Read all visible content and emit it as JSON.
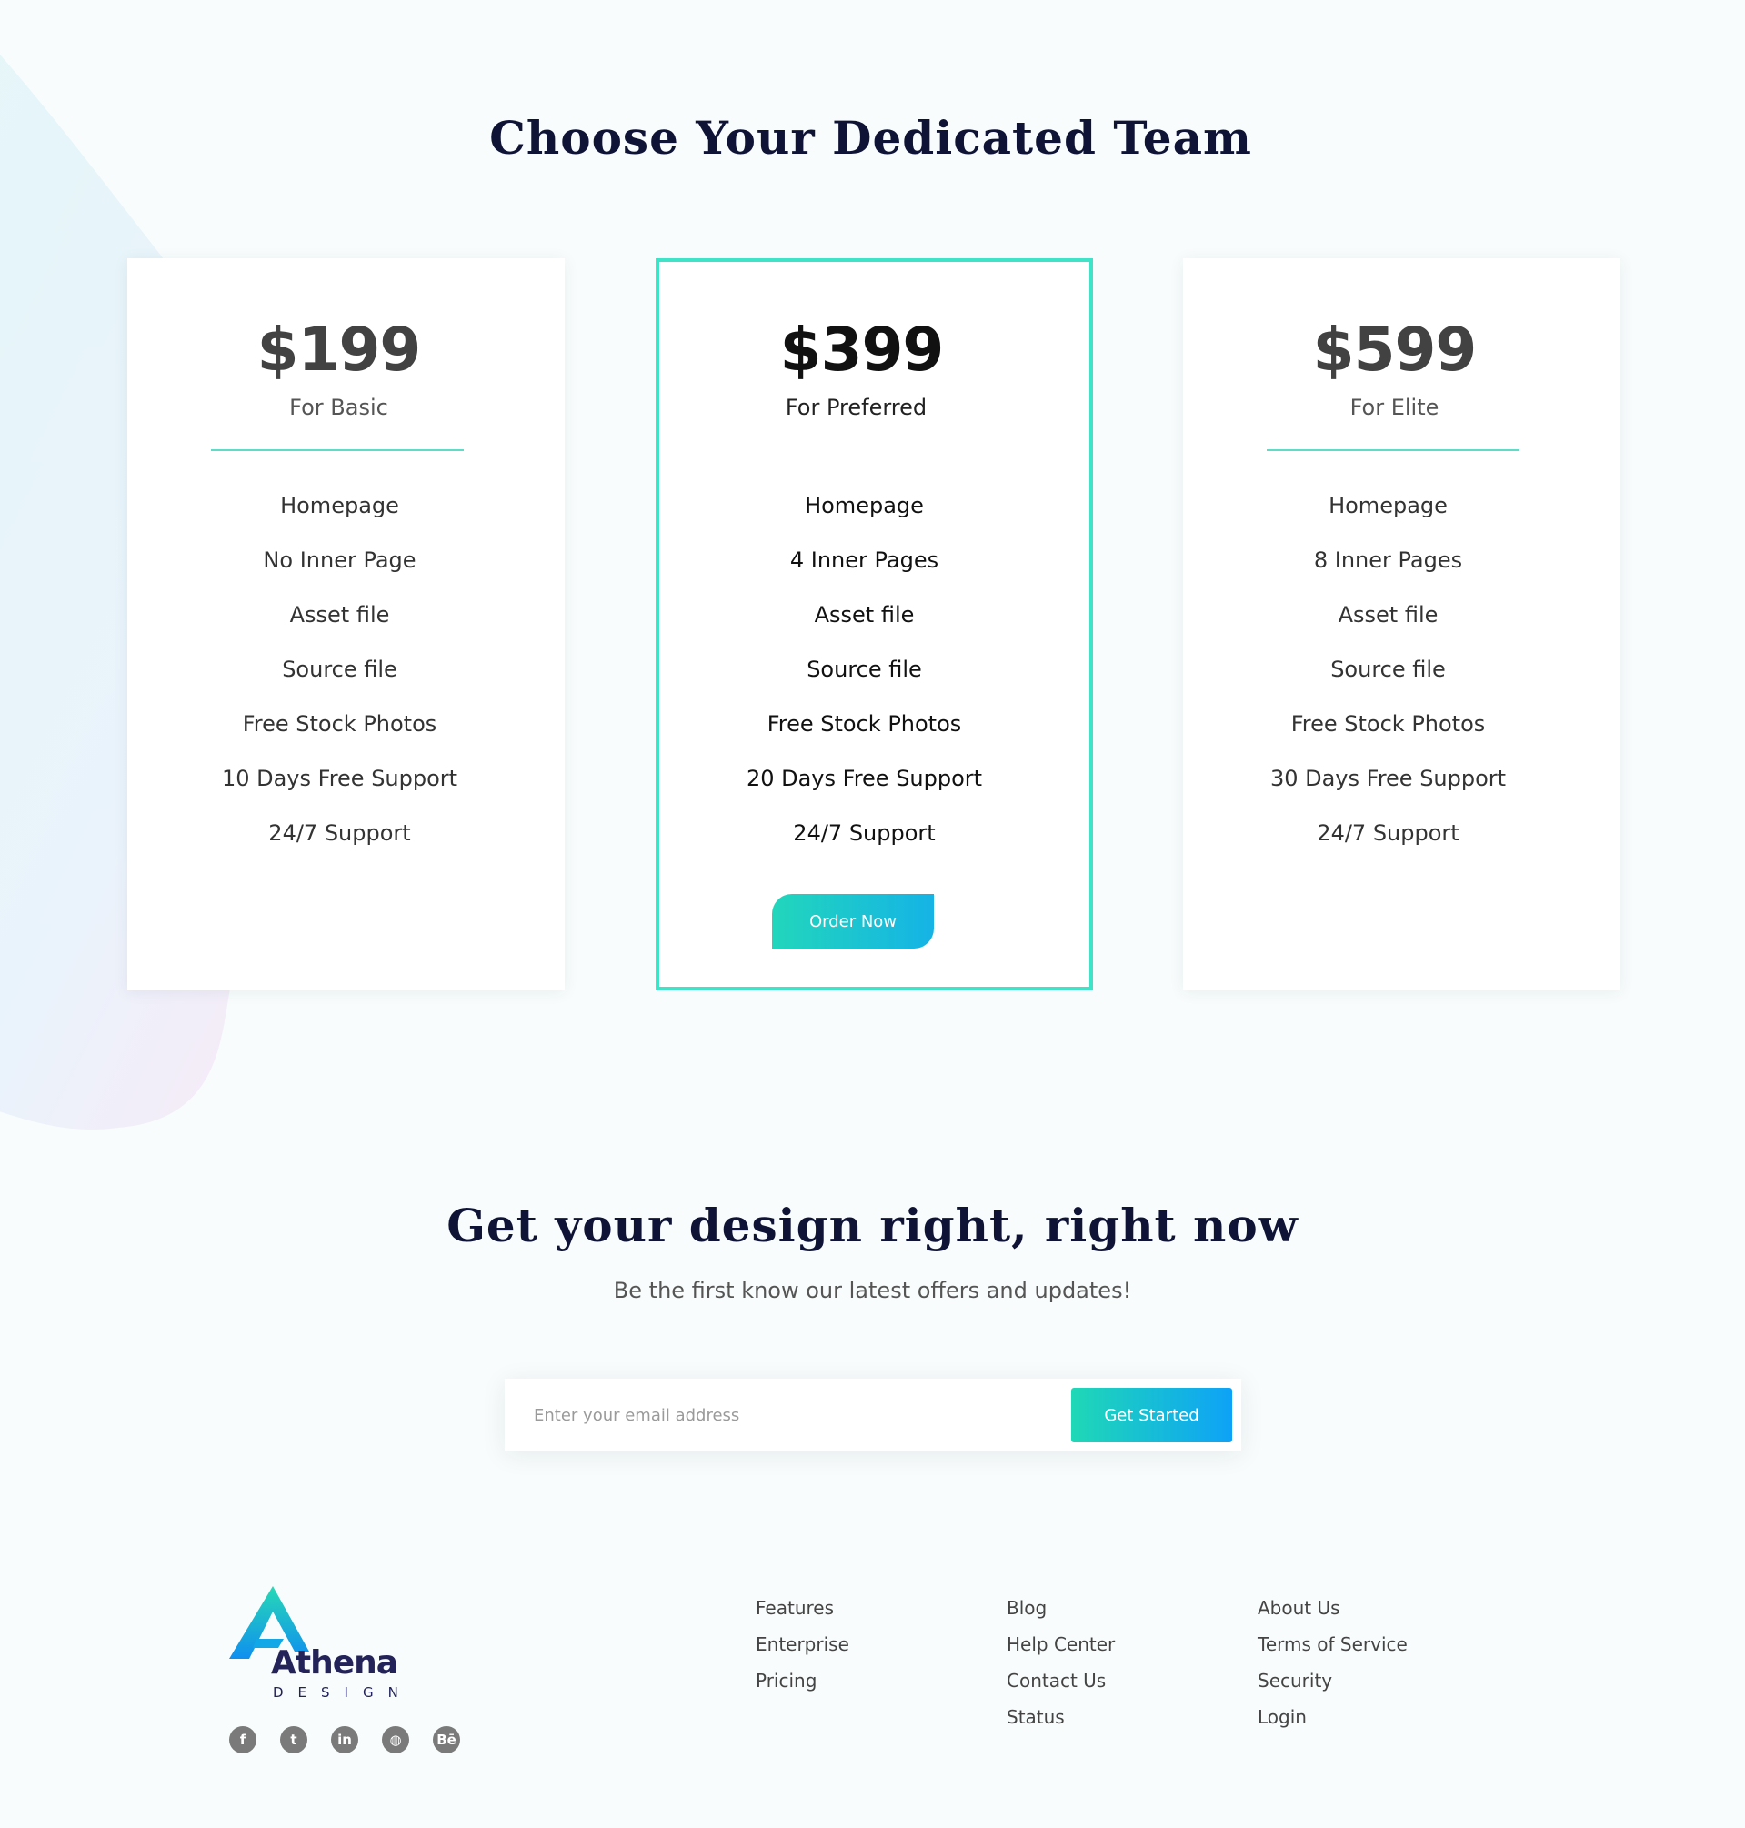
{
  "pricing": {
    "title": "Choose Your Dedicated Team",
    "plans": [
      {
        "price": "$199",
        "name": "For Basic",
        "features": [
          "Homepage",
          "No Inner Page",
          "Asset file",
          "Source file",
          "Free Stock Photos",
          "10 Days Free Support",
          "24/7 Support"
        ]
      },
      {
        "price": "$399",
        "name": "For Preferred",
        "features": [
          "Homepage",
          "4 Inner Pages",
          "Asset file",
          "Source file",
          "Free Stock Photos",
          "20 Days Free Support",
          "24/7 Support"
        ],
        "cta": "Order Now"
      },
      {
        "price": "$599",
        "name": "For Elite",
        "features": [
          "Homepage",
          "8 Inner Pages",
          "Asset file",
          "Source file",
          "Free Stock Photos",
          "30 Days Free Support",
          "24/7 Support"
        ]
      }
    ],
    "accent_color": "#3fe3c7"
  },
  "newsletter": {
    "title": "Get your design right, right now",
    "subtitle": "Be the first know our latest offers and updates!",
    "email_placeholder": "Enter your email address",
    "email_value": "",
    "button_label": "Get Started"
  },
  "footer": {
    "logo": {
      "name": "Athena",
      "tagline": "DESIGN"
    },
    "socials": [
      {
        "icon": "facebook-icon",
        "glyph": "f"
      },
      {
        "icon": "twitter-icon",
        "glyph": "t"
      },
      {
        "icon": "linkedin-icon",
        "glyph": "in"
      },
      {
        "icon": "dribbble-icon",
        "glyph": "◍"
      },
      {
        "icon": "behance-icon",
        "glyph": "Bē"
      }
    ],
    "columns": [
      [
        "Features",
        "Enterprise",
        "Pricing"
      ],
      [
        "Blog",
        "Help Center",
        "Contact Us",
        "Status"
      ],
      [
        "About Us",
        "Terms of Service",
        "Security",
        "Login"
      ]
    ]
  }
}
